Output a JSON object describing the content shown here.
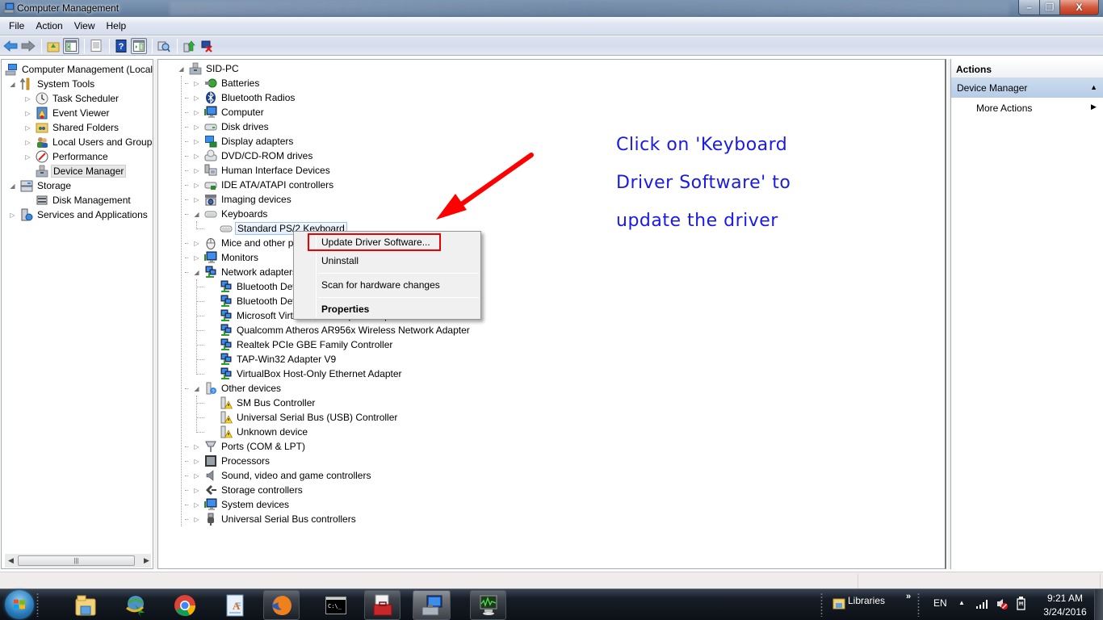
{
  "window": {
    "title": "Computer Management",
    "controls": {
      "minimize": "minimize",
      "maximize": "restore",
      "close": "close"
    }
  },
  "menubar": [
    "File",
    "Action",
    "View",
    "Help"
  ],
  "toolbar": [
    {
      "name": "back-icon"
    },
    {
      "name": "forward-icon"
    },
    {
      "sep": true
    },
    {
      "name": "up-folder-icon"
    },
    {
      "name": "show-hide-console-tree-icon",
      "pressed": true
    },
    {
      "sep": true
    },
    {
      "name": "properties-icon"
    },
    {
      "sep": true
    },
    {
      "name": "help-icon"
    },
    {
      "name": "show-hide-action-pane-icon",
      "pressed": true
    },
    {
      "sep": true
    },
    {
      "name": "scan-hardware-icon"
    },
    {
      "sep": true
    },
    {
      "name": "update-driver-icon"
    },
    {
      "name": "uninstall-icon"
    }
  ],
  "left_tree": [
    {
      "label": "Computer Management (Local",
      "icon": "computer-management-icon",
      "level": 0,
      "twisty": ""
    },
    {
      "label": "System Tools",
      "icon": "tools-icon",
      "level": 1,
      "twisty": "expanded"
    },
    {
      "label": "Task Scheduler",
      "icon": "clock-icon",
      "level": 2,
      "twisty": "collapsed"
    },
    {
      "label": "Event Viewer",
      "icon": "event-viewer-icon",
      "level": 2,
      "twisty": "collapsed"
    },
    {
      "label": "Shared Folders",
      "icon": "shared-folder-icon",
      "level": 2,
      "twisty": "collapsed"
    },
    {
      "label": "Local Users and Groups",
      "icon": "users-icon",
      "level": 2,
      "twisty": "collapsed"
    },
    {
      "label": "Performance",
      "icon": "performance-icon",
      "level": 2,
      "twisty": "collapsed"
    },
    {
      "label": "Device Manager",
      "icon": "device-manager-icon",
      "level": 2,
      "twisty": "",
      "selected": true
    },
    {
      "label": "Storage",
      "icon": "storage-icon",
      "level": 1,
      "twisty": "expanded"
    },
    {
      "label": "Disk Management",
      "icon": "disk-management-icon",
      "level": 2,
      "twisty": ""
    },
    {
      "label": "Services and Applications",
      "icon": "services-icon",
      "level": 1,
      "twisty": "collapsed"
    }
  ],
  "device_tree": [
    {
      "label": "SID-PC",
      "icon": "computer-icon",
      "level": 0,
      "twisty": "expanded"
    },
    {
      "label": "Batteries",
      "icon": "battery-icon",
      "level": 1,
      "twisty": "collapsed"
    },
    {
      "label": "Bluetooth Radios",
      "icon": "bluetooth-icon",
      "level": 1,
      "twisty": "collapsed"
    },
    {
      "label": "Computer",
      "icon": "monitor-icon",
      "level": 1,
      "twisty": "collapsed"
    },
    {
      "label": "Disk drives",
      "icon": "disk-drive-icon",
      "level": 1,
      "twisty": "collapsed"
    },
    {
      "label": "Display adapters",
      "icon": "display-adapter-icon",
      "level": 1,
      "twisty": "collapsed"
    },
    {
      "label": "DVD/CD-ROM drives",
      "icon": "dvd-drive-icon",
      "level": 1,
      "twisty": "collapsed"
    },
    {
      "label": "Human Interface Devices",
      "icon": "hid-icon",
      "level": 1,
      "twisty": "collapsed"
    },
    {
      "label": "IDE ATA/ATAPI controllers",
      "icon": "ide-controller-icon",
      "level": 1,
      "twisty": "collapsed"
    },
    {
      "label": "Imaging devices",
      "icon": "camera-icon",
      "level": 1,
      "twisty": "collapsed"
    },
    {
      "label": "Keyboards",
      "icon": "keyboard-icon",
      "level": 1,
      "twisty": "expanded"
    },
    {
      "label": "Standard PS/2 Keyboard",
      "icon": "keyboard-icon",
      "level": 2,
      "twisty": "",
      "selected": true
    },
    {
      "label": "Mice and other pointing devices",
      "icon": "mouse-icon",
      "level": 1,
      "twisty": "collapsed"
    },
    {
      "label": "Monitors",
      "icon": "monitor-icon",
      "level": 1,
      "twisty": "collapsed"
    },
    {
      "label": "Network adapters",
      "icon": "network-adapter-icon",
      "level": 1,
      "twisty": "expanded"
    },
    {
      "label": "Bluetooth Device (Personal Area Network)",
      "icon": "network-adapter-icon",
      "level": 2,
      "twisty": ""
    },
    {
      "label": "Bluetooth Device (RFCOMM Protocol TDI)",
      "icon": "network-adapter-icon",
      "level": 2,
      "twisty": ""
    },
    {
      "label": "Microsoft Virtual WiFi Miniport Adapter",
      "icon": "network-adapter-icon",
      "level": 2,
      "twisty": ""
    },
    {
      "label": "Qualcomm Atheros AR956x Wireless Network Adapter",
      "icon": "network-adapter-icon",
      "level": 2,
      "twisty": ""
    },
    {
      "label": "Realtek PCIe GBE Family Controller",
      "icon": "network-adapter-icon",
      "level": 2,
      "twisty": ""
    },
    {
      "label": "TAP-Win32 Adapter V9",
      "icon": "network-adapter-icon",
      "level": 2,
      "twisty": ""
    },
    {
      "label": "VirtualBox Host-Only Ethernet Adapter",
      "icon": "network-adapter-icon",
      "level": 2,
      "twisty": ""
    },
    {
      "label": "Other devices",
      "icon": "unknown-device-icon",
      "level": 1,
      "twisty": "expanded"
    },
    {
      "label": "SM Bus Controller",
      "icon": "warning-device-icon",
      "level": 2,
      "twisty": ""
    },
    {
      "label": "Universal Serial Bus (USB) Controller",
      "icon": "warning-device-icon",
      "level": 2,
      "twisty": ""
    },
    {
      "label": "Unknown device",
      "icon": "warning-device-icon",
      "level": 2,
      "twisty": ""
    },
    {
      "label": "Ports (COM & LPT)",
      "icon": "port-icon",
      "level": 1,
      "twisty": "collapsed"
    },
    {
      "label": "Processors",
      "icon": "processor-icon",
      "level": 1,
      "twisty": "collapsed"
    },
    {
      "label": "Sound, video and game controllers",
      "icon": "speaker-icon",
      "level": 1,
      "twisty": "collapsed"
    },
    {
      "label": "Storage controllers",
      "icon": "storage-controller-icon",
      "level": 1,
      "twisty": "collapsed"
    },
    {
      "label": "System devices",
      "icon": "monitor-icon",
      "level": 1,
      "twisty": "collapsed"
    },
    {
      "label": "Universal Serial Bus controllers",
      "icon": "usb-icon",
      "level": 1,
      "twisty": "collapsed"
    }
  ],
  "context_menu": {
    "items": [
      {
        "label": "Update Driver Software...",
        "highlighted": true
      },
      {
        "label": "Uninstall"
      },
      {
        "separator": true
      },
      {
        "label": "Scan for hardware changes"
      },
      {
        "separator": true
      },
      {
        "label": "Properties",
        "bold": true
      }
    ]
  },
  "annotation": {
    "lines": [
      "Click on 'Keyboard",
      "Driver Software' to",
      "update the driver"
    ],
    "color": "#1a1ae6",
    "arrow_color": "#ff0000"
  },
  "actions_pane": {
    "header": "Actions",
    "section": "Device Manager",
    "items": [
      "More Actions"
    ]
  },
  "taskbar": {
    "pinned": [
      {
        "name": "windows-explorer-icon"
      },
      {
        "name": "internet-download-manager-icon"
      },
      {
        "name": "chrome-icon"
      },
      {
        "name": "wordpad-icon"
      },
      {
        "name": "firefox-icon",
        "active": true
      },
      {
        "name": "command-prompt-icon"
      },
      {
        "name": "toolbox-icon",
        "active": true
      },
      {
        "name": "computer-management-icon",
        "active": true,
        "current": true
      },
      {
        "name": "performance-monitor-icon",
        "active": true
      }
    ],
    "toolbar_label": "Libraries",
    "language": "EN",
    "time": "9:21 AM",
    "date": "3/24/2016"
  }
}
